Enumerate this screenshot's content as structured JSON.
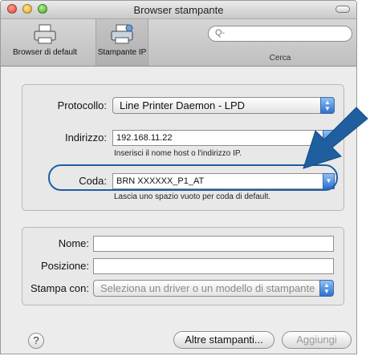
{
  "window": {
    "title": "Browser stampante"
  },
  "toolbar": {
    "default_label": "Browser di default",
    "ip_label": "Stampante IP",
    "search_placeholder": "Q-",
    "search_caption": "Cerca"
  },
  "top_panel": {
    "protocol_label": "Protocollo:",
    "protocol_value": "Line Printer Daemon - LPD",
    "address_label": "Indirizzo:",
    "address_value": "192.168.11.22",
    "address_hint": "Inserisci il nome host o l'indirizzo IP.",
    "queue_label": "Coda:",
    "queue_value": "BRN XXXXXX_P1_AT",
    "queue_hint": "Lascia uno spazio vuoto per coda di default."
  },
  "bottom_panel": {
    "name_label": "Nome:",
    "name_value": "",
    "location_label": "Posizione:",
    "location_value": "",
    "print_with_label": "Stampa con:",
    "print_with_value": "Seleziona un driver o un modello di stampante"
  },
  "buttons": {
    "help": "?",
    "more_printers": "Altre stampanti...",
    "add": "Aggiungi"
  },
  "colors": {
    "highlight": "#1f5fa0",
    "arrow": "#1f5fa0",
    "accent": "#2d6fd1"
  }
}
